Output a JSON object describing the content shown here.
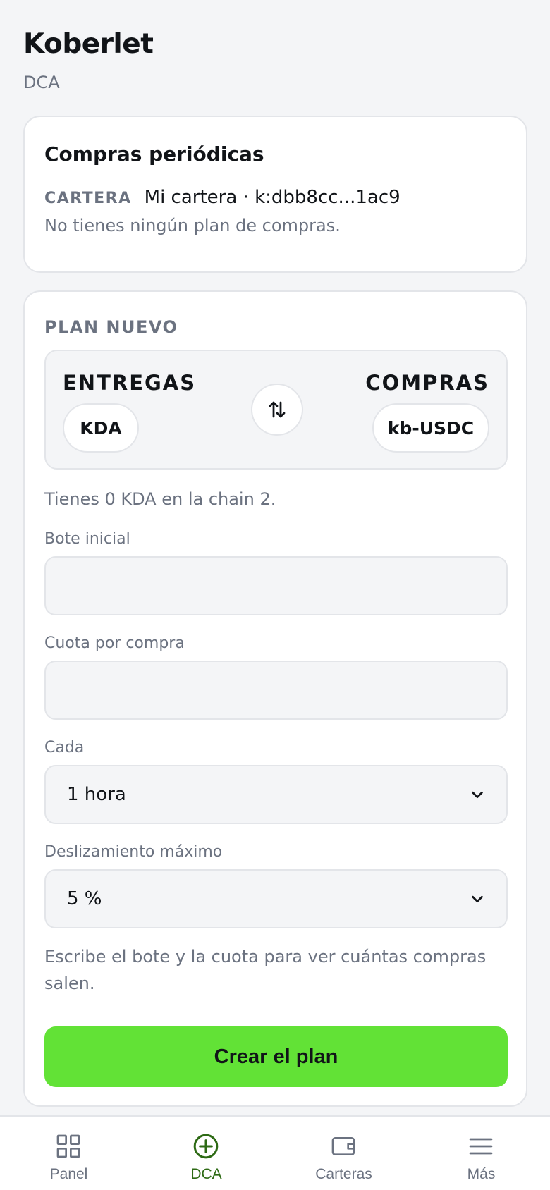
{
  "header": {
    "title": "Koberlet",
    "subtitle": "DCA"
  },
  "summary": {
    "title": "Compras periódicas",
    "wallet_label": "CARTERA",
    "wallet_value": "Mi cartera · k:dbb8cc...1ac9",
    "empty_text": "No tienes ningún plan de compras."
  },
  "plan": {
    "heading": "PLAN NUEVO",
    "give_label": "ENTREGAS",
    "give_token": "KDA",
    "get_label": "COMPRAS",
    "get_token": "kb-USDC",
    "swap_icon": "swap-vertical-icon",
    "balance_text": "Tienes 0 KDA en la chain 2.",
    "initial_label": "Bote inicial",
    "initial_value": "",
    "installment_label": "Cuota por compra",
    "installment_value": "",
    "interval_label": "Cada",
    "interval_value": "1 hora",
    "slippage_label": "Deslizamiento máximo",
    "slippage_value": "5 %",
    "hint_text": "Escribe el bote y la cuota para ver cuántas compras salen.",
    "create_label": "Crear el plan"
  },
  "nav": {
    "items": [
      {
        "label": "Panel",
        "icon": "grid-icon",
        "active": false
      },
      {
        "label": "DCA",
        "icon": "plus-circle-icon",
        "active": true
      },
      {
        "label": "Carteras",
        "icon": "wallet-icon",
        "active": false
      },
      {
        "label": "Más",
        "icon": "menu-icon",
        "active": false
      }
    ]
  },
  "colors": {
    "accent": "#62e236",
    "active_nav": "#2d6a14",
    "muted_text": "#6b7280",
    "background": "#f4f5f7"
  }
}
